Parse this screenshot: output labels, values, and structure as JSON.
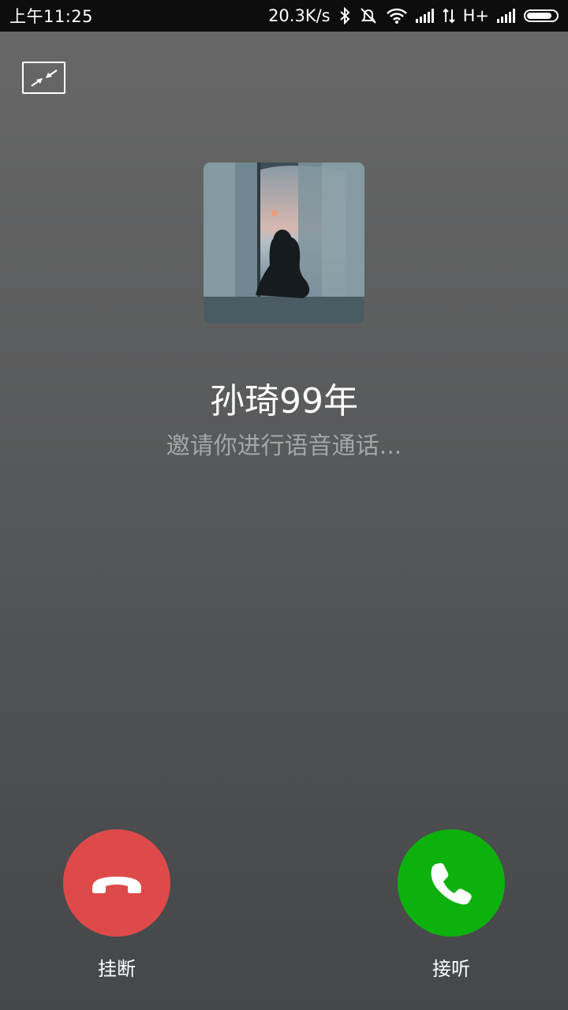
{
  "status_bar": {
    "time": "上午11:25",
    "network_speed": "20.3K/s",
    "network_type": "H+",
    "icons": [
      "bluetooth-icon",
      "alarm-off-icon",
      "wifi-icon",
      "signal-icon",
      "data-transfer-icon",
      "signal-icon-2",
      "battery-icon"
    ],
    "battery_level": 0.85
  },
  "call": {
    "minimize_icon": "minimize-window-icon",
    "caller_name": "孙琦99年",
    "status_text": "邀请你进行语音通话...",
    "decline_label": "挂断",
    "accept_label": "接听",
    "decline_color": "#de4a4a",
    "accept_color": "#0db10d"
  }
}
